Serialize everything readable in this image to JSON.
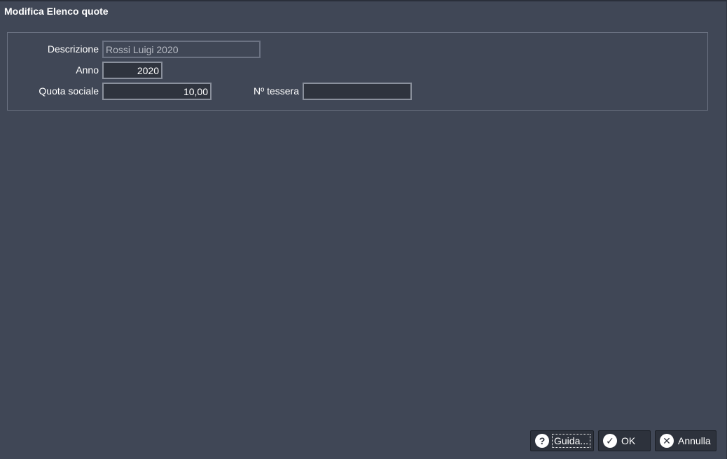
{
  "window": {
    "title": "Modifica Elenco quote"
  },
  "form": {
    "descrizione": {
      "label": "Descrizione",
      "value": "Rossi Luigi 2020"
    },
    "anno": {
      "label": "Anno",
      "value": "2020"
    },
    "quota_sociale": {
      "label": "Quota sociale",
      "value": "10,00"
    },
    "n_tessera": {
      "label": "Nº tessera",
      "value": ""
    }
  },
  "buttons": {
    "guida": "Guida...",
    "ok": "OK",
    "annulla": "Annulla"
  },
  "icons": {
    "guida": "help-icon",
    "ok": "check-icon",
    "annulla": "close-icon"
  }
}
